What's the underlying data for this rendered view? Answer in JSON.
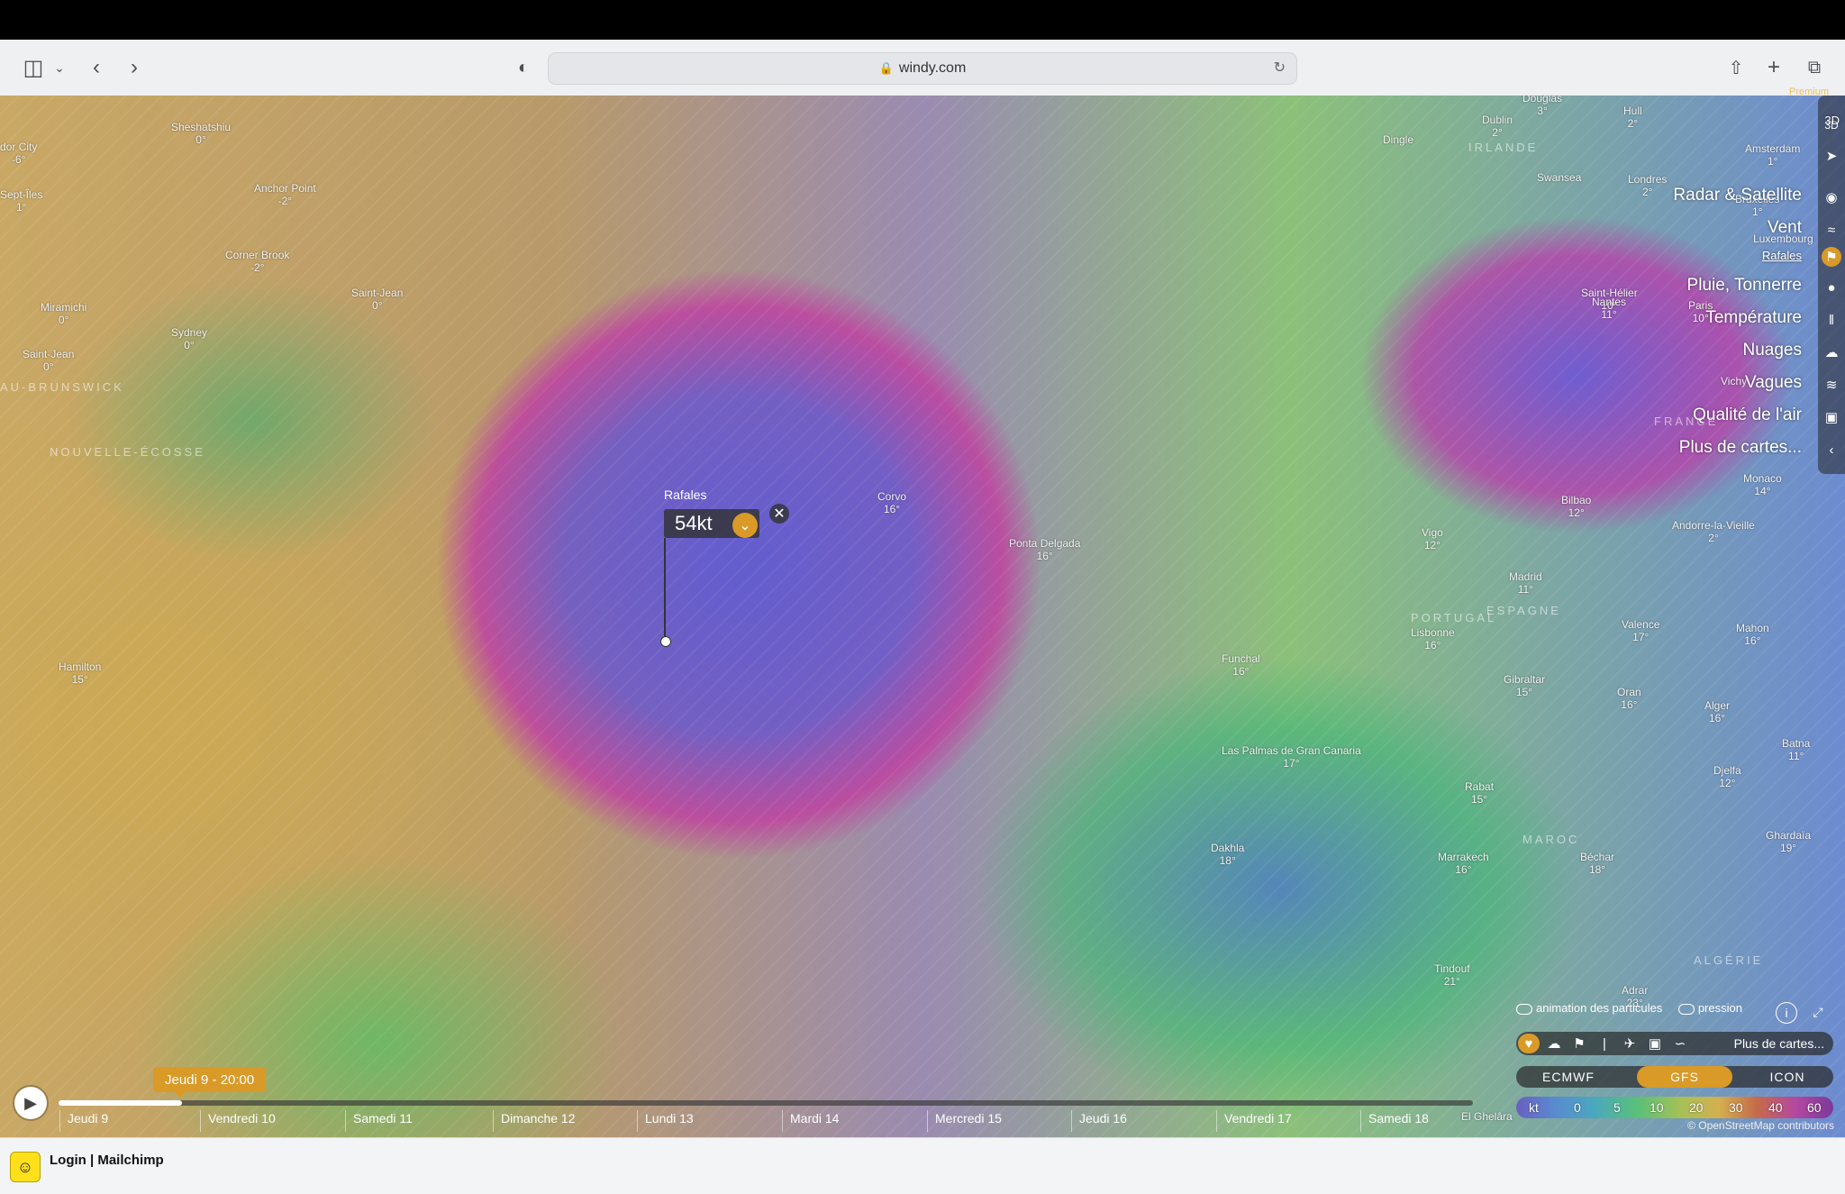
{
  "browser": {
    "url": "windy.com",
    "lock_icon": "lock-icon"
  },
  "popup": {
    "title": "Rafales",
    "value": "54kt"
  },
  "cities": [
    {
      "name": "Sheshatshiu",
      "temp": "0°"
    },
    {
      "name": "dor City",
      "temp": "-6°"
    },
    {
      "name": "Anchor Point",
      "temp": "-2°"
    },
    {
      "name": "Sept-Îles",
      "temp": "1°"
    },
    {
      "name": "Corner Brook",
      "temp": "-2°"
    },
    {
      "name": "Saint-Jean",
      "temp": "0°"
    },
    {
      "name": "Miramichi",
      "temp": "0°"
    },
    {
      "name": "Sydney",
      "temp": "0°"
    },
    {
      "name": "Saint-Jean",
      "temp": "0°"
    },
    {
      "name": "Hamilton",
      "temp": "15°"
    },
    {
      "name": "Corvo",
      "temp": "16°"
    },
    {
      "name": "Ponta Delgada",
      "temp": "16°"
    },
    {
      "name": "Funchal",
      "temp": "16°"
    },
    {
      "name": "Las Palmas de Gran Canaria",
      "temp": "17°"
    },
    {
      "name": "Dakhla",
      "temp": "18°"
    },
    {
      "name": "Douglas",
      "temp": "3°"
    },
    {
      "name": "Dublin",
      "temp": "2°"
    },
    {
      "name": "Hull",
      "temp": "2°"
    },
    {
      "name": "Amsterdam",
      "temp": "1°"
    },
    {
      "name": "Dingle",
      "temp": ""
    },
    {
      "name": "Swansea",
      "temp": ""
    },
    {
      "name": "Londres",
      "temp": "2°"
    },
    {
      "name": "Bruxelles",
      "temp": "1°"
    },
    {
      "name": "Luxembourg",
      "temp": ""
    },
    {
      "name": "Saint-Hélier",
      "temp": "10°"
    },
    {
      "name": "Paris",
      "temp": "10°"
    },
    {
      "name": "Nantes",
      "temp": "11°"
    },
    {
      "name": "Vichy",
      "temp": ""
    },
    {
      "name": "Bilbao",
      "temp": "12°"
    },
    {
      "name": "Andorre-la-Vieille",
      "temp": "2°"
    },
    {
      "name": "Monaco",
      "temp": "14°"
    },
    {
      "name": "Vigo",
      "temp": "12°"
    },
    {
      "name": "Madrid",
      "temp": "11°"
    },
    {
      "name": "Valence",
      "temp": "17°"
    },
    {
      "name": "Mahon",
      "temp": "16°"
    },
    {
      "name": "Lisbonne",
      "temp": "16°"
    },
    {
      "name": "Gibraltar",
      "temp": "15°"
    },
    {
      "name": "Oran",
      "temp": "16°"
    },
    {
      "name": "Alger",
      "temp": "16°"
    },
    {
      "name": "Batna",
      "temp": "11°"
    },
    {
      "name": "Djelfa",
      "temp": "12°"
    },
    {
      "name": "Rabat",
      "temp": "15°"
    },
    {
      "name": "Marrakech",
      "temp": "16°"
    },
    {
      "name": "Béchar",
      "temp": "18°"
    },
    {
      "name": "Ghardaïa",
      "temp": "19°"
    },
    {
      "name": "Tindouf",
      "temp": "21°"
    },
    {
      "name": "Adrar",
      "temp": "23°"
    },
    {
      "name": "El Ghelâra",
      "temp": ""
    }
  ],
  "countries": [
    "IRLANDE",
    "FRANCE",
    "PORTUGAL",
    "ESPAGNE",
    "MAROC",
    "ALGÉRIE",
    "NOUVELLE-ÉCOSSE",
    "AU-BRUNSWICK"
  ],
  "layers": [
    {
      "label": "3D",
      "icon": "3d-icon"
    },
    {
      "label": "",
      "icon": "compass-icon"
    },
    {
      "label": "Radar & Satellite",
      "icon": "globe-icon"
    },
    {
      "label": "Vent",
      "icon": "wind-icon"
    },
    {
      "label": "Rafales",
      "icon": "flag-icon",
      "active": true
    },
    {
      "label": "Pluie, Tonnerre",
      "icon": "drop-icon"
    },
    {
      "label": "Température",
      "icon": "thermometer-icon"
    },
    {
      "label": "Nuages",
      "icon": "cloud-icon"
    },
    {
      "label": "Vagues",
      "icon": "waves-icon"
    },
    {
      "label": "Qualité de l'air",
      "icon": "car-icon"
    },
    {
      "label": "Plus de cartes...",
      "icon": "chevron-left-icon"
    }
  ],
  "premium": "Premium",
  "options": {
    "particles": "animation des particules",
    "pressure": "pression"
  },
  "quickbar": {
    "more": "Plus de cartes..."
  },
  "models": [
    "ECMWF",
    "GFS",
    "ICON"
  ],
  "active_model": "GFS",
  "scale": {
    "unit": "kt",
    "values": [
      "0",
      "5",
      "10",
      "20",
      "30",
      "40",
      "60"
    ]
  },
  "attribution": "© OpenStreetMap contributors",
  "timeline": {
    "current": "Jeudi 9 - 20:00",
    "days": [
      "Jeudi 9",
      "Vendredi 10",
      "Samedi 11",
      "Dimanche 12",
      "Lundi 13",
      "Mardi 14",
      "Mercredi 15",
      "Jeudi 16",
      "Vendredi 17",
      "Samedi 18"
    ],
    "progress": 0.087
  },
  "statusbar": {
    "label": "Login | Mailchimp"
  },
  "colors": {
    "accent": "#d99a28"
  }
}
